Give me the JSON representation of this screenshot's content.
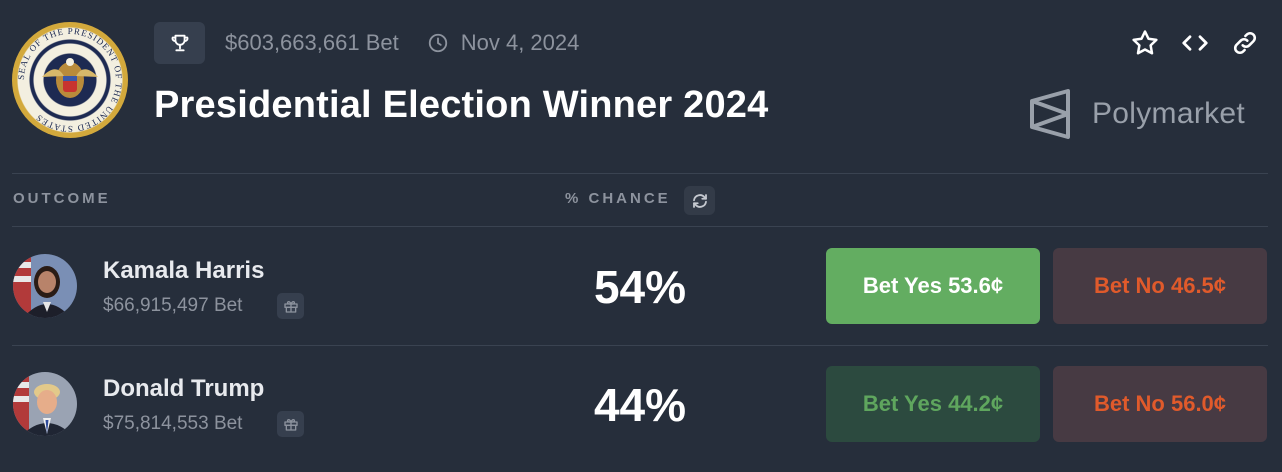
{
  "header": {
    "total_bet": "$603,663,661 Bet",
    "date": "Nov 4, 2024",
    "title": "Presidential Election Winner 2024",
    "brand": "Polymarket",
    "seal_text": "SEAL OF THE PRESIDENT OF THE UNITED STATES",
    "icons": [
      "trophy-icon",
      "clock-icon",
      "star-icon",
      "code-icon",
      "link-icon",
      "polymarket-logo-icon"
    ]
  },
  "table": {
    "col_outcome": "OUTCOME",
    "col_chance": "% CHANCE",
    "rows": [
      {
        "name": "Kamala Harris",
        "bet": "$66,915,497 Bet",
        "chance": "54%",
        "yes_label": "Bet Yes 53.6¢",
        "no_label": "Bet No 46.5¢"
      },
      {
        "name": "Donald Trump",
        "bet": "$75,814,553 Bet",
        "chance": "44%",
        "yes_label": "Bet Yes 44.2¢",
        "no_label": "Bet No 56.0¢"
      }
    ]
  },
  "colors": {
    "background": "#262e3b",
    "yes_active": "#63ad61",
    "yes_dim": "#2c4a3f",
    "no": "#473a43",
    "no_text": "#e05a2b"
  }
}
